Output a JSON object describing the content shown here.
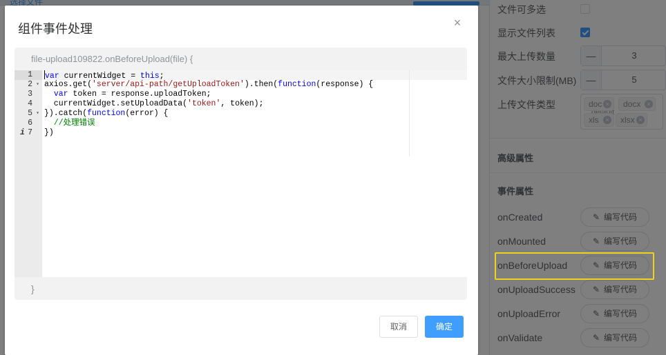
{
  "background": {
    "topbar_text": "选择文件"
  },
  "panel": {
    "multi_select_label": "文件可多选",
    "multi_select_checked": false,
    "show_list_label": "显示文件列表",
    "show_list_checked": true,
    "max_count_label": "最大上传数量",
    "max_count_value": "3",
    "size_limit_label": "文件大小限制(MB)",
    "size_limit_value": "5",
    "file_types_label": "上传文件类型",
    "file_types": [
      "doc",
      "docx",
      "xls",
      "xlsx"
    ],
    "file_types_placeholder": "default",
    "minus_symbol": "—",
    "advanced_title": "高级属性",
    "events_title": "事件属性",
    "events": [
      {
        "label": "onCreated",
        "button": "编写代码"
      },
      {
        "label": "onMounted",
        "button": "编写代码"
      },
      {
        "label": "onBeforeUpload",
        "button": "编写代码"
      },
      {
        "label": "onUploadSuccess",
        "button": "编写代码"
      },
      {
        "label": "onUploadError",
        "button": "编写代码"
      },
      {
        "label": "onValidate",
        "button": "编写代码"
      }
    ],
    "highlight_color": "#f0d41c"
  },
  "dialog": {
    "title": "组件事件处理",
    "close_glyph": "×",
    "signature": "file-upload109822.onBeforeUpload(file) {",
    "closing_brace": "}",
    "cancel_label": "取消",
    "ok_label": "确定",
    "accent_color": "#409eff"
  },
  "code": {
    "lines": [
      {
        "num": "1",
        "text": "var currentWidget = this;",
        "fold": false,
        "info": false
      },
      {
        "num": "2",
        "text": "axios.get('server/api-path/getUploadToken').then(function(response) {",
        "fold": true,
        "info": false
      },
      {
        "num": "3",
        "text": "  var token = response.uploadToken;",
        "fold": false,
        "info": false
      },
      {
        "num": "4",
        "text": "  currentWidget.setUploadData('token', token);",
        "fold": false,
        "info": false
      },
      {
        "num": "5",
        "text": "}).catch(function(error) {",
        "fold": true,
        "info": false
      },
      {
        "num": "6",
        "text": "  //处理错误",
        "fold": false,
        "info": false
      },
      {
        "num": "7",
        "text": "})",
        "fold": false,
        "info": true
      }
    ]
  }
}
